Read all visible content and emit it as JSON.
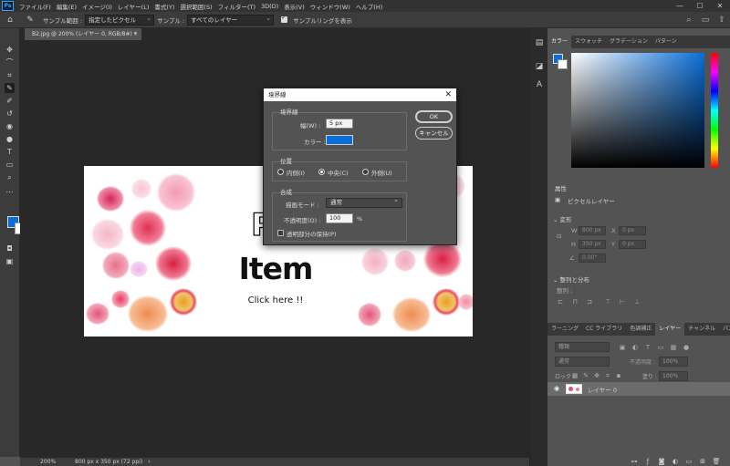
{
  "app": {
    "logo_text": "Ps",
    "menu": [
      "ファイル(F)",
      "編集(E)",
      "イメージ(I)",
      "レイヤー(L)",
      "書式(Y)",
      "選択範囲(S)",
      "フィルター(T)",
      "3D(D)",
      "表示(V)",
      "ウィンドウ(W)",
      "ヘルプ(H)"
    ],
    "window_controls": {
      "minimize": "—",
      "maximize": "☐",
      "close": "✕"
    }
  },
  "options_bar": {
    "sample_size_label": "サンプル範囲 :",
    "sample_size_value": "指定したピクセル",
    "sample_label": "サンプル :",
    "sample_value": "すべてのレイヤー",
    "show_ring_label": "サンプルリングを表示",
    "show_ring_checked": true
  },
  "document": {
    "tab_title": "B2.jpg @ 200% (レイヤー 0, RGB/8#) *",
    "tab_close": "×",
    "zoom": "200%",
    "info": "800 px x 350 px (72 ppi)",
    "status_arrow": "›"
  },
  "canvas": {
    "title_text": "Pic",
    "item_text": "Item",
    "click_text": "Click here !!"
  },
  "colors": {
    "foreground": "#0a6ed8",
    "background": "#ffffff",
    "stroke_color": "#0a6ed8"
  },
  "dialog": {
    "title": "境界線",
    "close": "✕",
    "stroke_group": "境界線",
    "width_label": "幅(W) :",
    "width_value": "5 px",
    "color_label": "カラー :",
    "location_group": "位置",
    "inside_label": "内側(I)",
    "center_label": "中央(C)",
    "outside_label": "外側(U)",
    "selected_location": "center",
    "blend_group": "合成",
    "mode_label": "描画モード :",
    "mode_value": "通常",
    "opacity_label": "不透明度(O) :",
    "opacity_value": "100",
    "opacity_unit": "%",
    "preserve_label": "透明部分の保持(P)",
    "ok_label": "OK",
    "cancel_label": "キャンセル"
  },
  "color_panel": {
    "tabs": [
      "カラー",
      "スウォッチ",
      "グラデーション",
      "パターン"
    ],
    "active_tab": 0
  },
  "properties_panel": {
    "title": "属性",
    "layer_type": "ピクセルレイヤー",
    "transform_title": "変形",
    "w_label": "W",
    "w_value": "800 px",
    "h_label": "H",
    "h_value": "350 px",
    "x_label": "X",
    "x_value": "0 px",
    "y_label": "Y",
    "y_value": "0 px",
    "angle_value": "0.00°",
    "align_title": "整列と分布",
    "align_sub": "整列 :"
  },
  "layers_panel": {
    "tabs": [
      "ラーニング",
      "CC ライブラリ",
      "色調補正",
      "レイヤー",
      "チャンネル",
      "パス"
    ],
    "active_tab": 3,
    "filter_kind": "種類",
    "blend_mode": "通常",
    "opacity_label": "不透明度 :",
    "opacity_value": "100%",
    "lock_label": "ロック :",
    "fill_label": "塗り :",
    "fill_value": "100%",
    "layer_name": "レイヤー 0"
  }
}
